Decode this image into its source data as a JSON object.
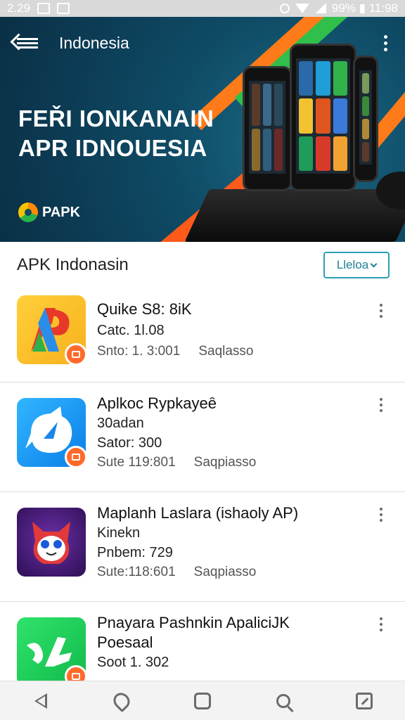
{
  "status_bar": {
    "time_left": "2.29",
    "battery_time": "99% ▮ 11:98"
  },
  "header": {
    "title": "Indonesia"
  },
  "hero": {
    "heading_line1": "FEŘI IONKANAIN",
    "heading_line2": "APR IDNOUESIA",
    "logo_text": "PAPK"
  },
  "section": {
    "title": "APK Indonasin",
    "sort_label": "Lleloa"
  },
  "apps": [
    {
      "name": "Quike S8: 8iK",
      "line2": "Catc. 1l.08",
      "line3_a": "Snto: 1. 3:001",
      "line3_b": "Saqlasso"
    },
    {
      "name": "Aplkoc Rypkayeȇ",
      "line2": "30adan",
      "line3": "Sator: 300",
      "line4_a": "Sute 119:801",
      "line4_b": "Saqpiasso"
    },
    {
      "name": "Maplanh Laslara (ishaoly AP)",
      "line2": "Kinekn",
      "line3": "Pnbem: 729",
      "line4_a": "Sute:118:601",
      "line4_b": "Saqpiasso"
    },
    {
      "name": "Pnayara Pashnkin ApaliciJK",
      "line2": "Poesaal",
      "line3": "Soot 1. 302"
    }
  ],
  "colors": {
    "accent": "#2aa0b4",
    "hero_bg": "#0f4b66",
    "badge": "#ff6a2a"
  }
}
